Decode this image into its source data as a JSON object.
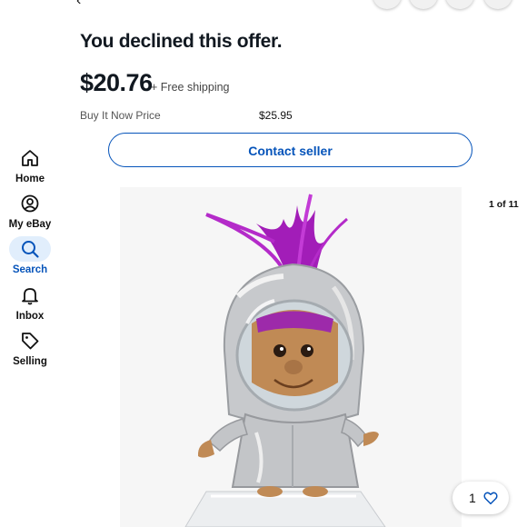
{
  "header": {
    "back_icon": "back-arrow-icon",
    "actions": [
      "search-icon",
      "cart-icon",
      "share-icon",
      "more-icon"
    ]
  },
  "sidebar": {
    "items": [
      {
        "label": "Home",
        "icon": "home-icon",
        "active": false
      },
      {
        "label": "My eBay",
        "icon": "user-icon",
        "active": false
      },
      {
        "label": "Search",
        "icon": "search-icon",
        "active": true
      },
      {
        "label": "Inbox",
        "icon": "bell-icon",
        "active": false
      },
      {
        "label": "Selling",
        "icon": "tag-icon",
        "active": false
      }
    ]
  },
  "offer": {
    "status": "You declined this offer.",
    "price": "$20.76",
    "shipping": "+ Free shipping",
    "bin_label": "Buy It Now Price",
    "bin_value": "$25.95",
    "contact_label": "Contact seller"
  },
  "gallery": {
    "counter": "1 of 11"
  },
  "watch": {
    "count": "1",
    "icon": "heart-icon"
  },
  "colors": {
    "accent": "#0654ba",
    "active_bg": "#e1eefc",
    "text": "#111820"
  }
}
